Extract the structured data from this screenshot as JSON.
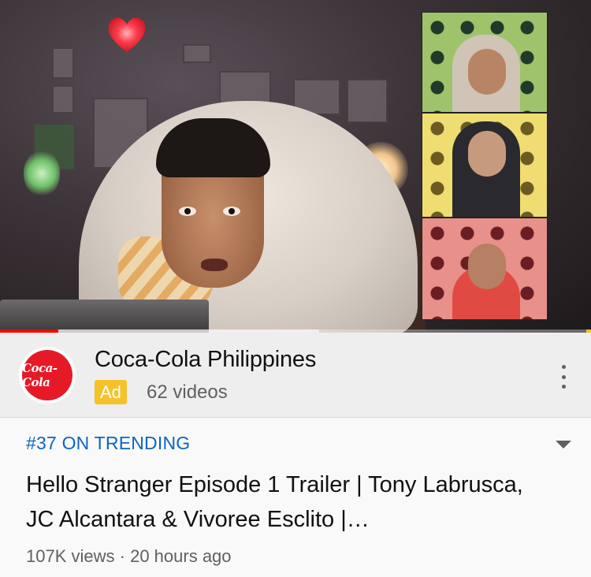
{
  "player": {
    "progress": {
      "played_fraction": 0.098,
      "buffered_fraction": 0.54
    },
    "ad_marker_color": "#f5c518",
    "accent_color": "#ff0000"
  },
  "channel": {
    "logo_text": "Coca-Cola",
    "name": "Coca-Cola Philippines",
    "ad_badge": "Ad",
    "video_count": "62 videos"
  },
  "video": {
    "trending": "#37 ON TRENDING",
    "title": "Hello Stranger Episode 1 Trailer | Tony Labrusca, JC Alcantara & Vivoree Esclito |…",
    "views": "107K views",
    "separator": "·",
    "age": "20 hours ago"
  },
  "colors": {
    "trending_blue": "#0b65c2",
    "ad_badge_yellow": "#f6c22a",
    "coca_cola_red": "#e61a27"
  },
  "icons": [
    "more-options-icon",
    "expand-chevron-icon"
  ]
}
